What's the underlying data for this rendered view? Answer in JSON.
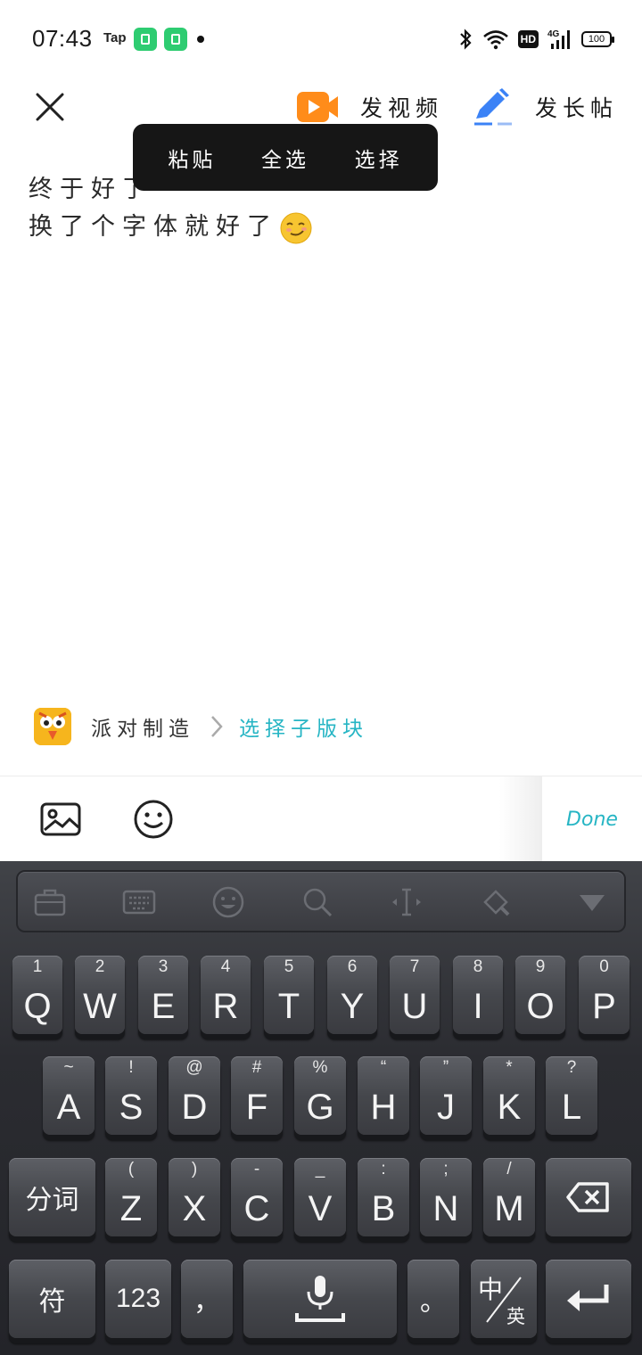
{
  "status_bar": {
    "time": "07:43",
    "tap_label": "Tap",
    "battery": "100",
    "hd_label": "HD",
    "network": "4G"
  },
  "top_bar": {
    "video_label": "发视频",
    "long_post_label": "发长帖"
  },
  "context_menu": {
    "items": [
      "粘贴",
      "全选",
      "选择"
    ]
  },
  "post": {
    "lines": [
      "终于好了",
      "换了个字体就好了"
    ]
  },
  "board": {
    "name": "派对制造",
    "select_label": "选择子版块"
  },
  "toolbar": {
    "done_label": "Done"
  },
  "keyboard": {
    "row1": [
      {
        "main": "Q",
        "sub": "1"
      },
      {
        "main": "W",
        "sub": "2"
      },
      {
        "main": "E",
        "sub": "3"
      },
      {
        "main": "R",
        "sub": "4"
      },
      {
        "main": "T",
        "sub": "5"
      },
      {
        "main": "Y",
        "sub": "6"
      },
      {
        "main": "U",
        "sub": "7"
      },
      {
        "main": "I",
        "sub": "8"
      },
      {
        "main": "O",
        "sub": "9"
      },
      {
        "main": "P",
        "sub": "0"
      }
    ],
    "row2": [
      {
        "main": "A",
        "sub": "~"
      },
      {
        "main": "S",
        "sub": "!"
      },
      {
        "main": "D",
        "sub": "@"
      },
      {
        "main": "F",
        "sub": "#"
      },
      {
        "main": "G",
        "sub": "%"
      },
      {
        "main": "H",
        "sub": "“"
      },
      {
        "main": "J",
        "sub": "”"
      },
      {
        "main": "K",
        "sub": "*"
      },
      {
        "main": "L",
        "sub": "?"
      }
    ],
    "row3": [
      {
        "main": "Z",
        "sub": "("
      },
      {
        "main": "X",
        "sub": ")"
      },
      {
        "main": "C",
        "sub": "-"
      },
      {
        "main": "V",
        "sub": "_"
      },
      {
        "main": "B",
        "sub": ":"
      },
      {
        "main": "N",
        "sub": ";"
      },
      {
        "main": "M",
        "sub": "/"
      }
    ],
    "segment_label": "分词",
    "symbol_label": "符",
    "numbers_label": "123",
    "comma_label": "，",
    "period_label": "。",
    "lang_cn": "中",
    "lang_en": "英"
  },
  "colors": {
    "accent": "#26b5c4",
    "video_icon": "#ff8c1a",
    "pen_icon": "#3b82f6",
    "menu_bg": "#161616"
  }
}
